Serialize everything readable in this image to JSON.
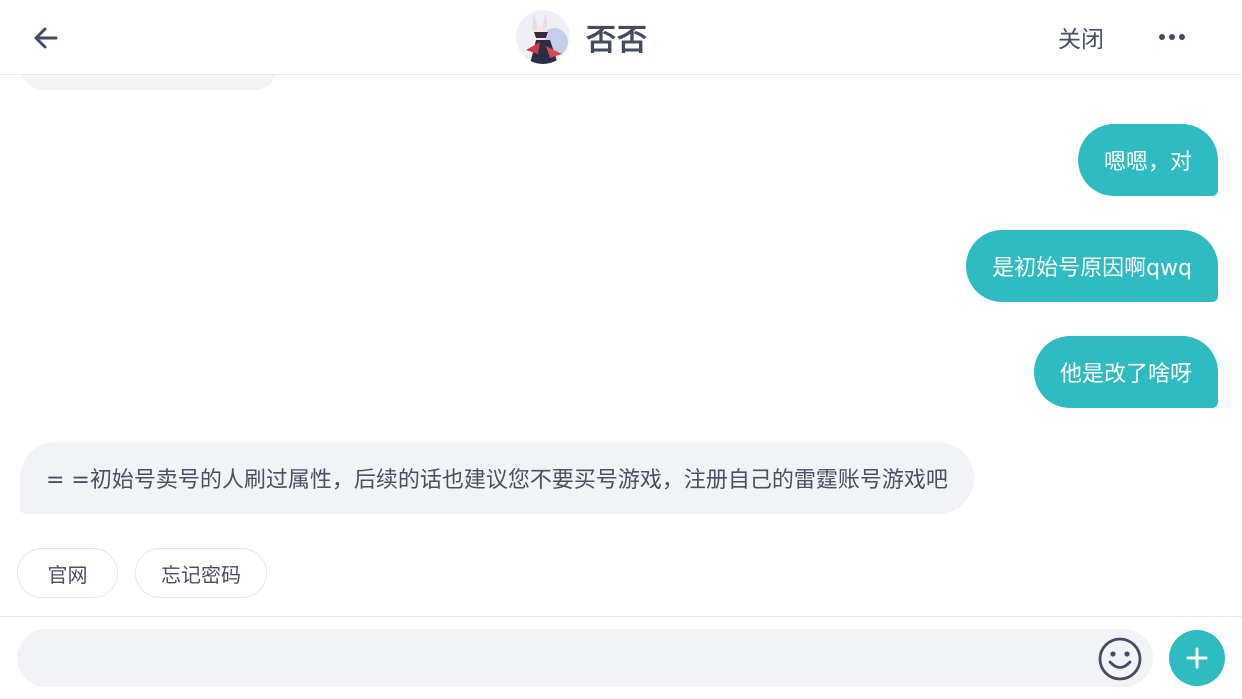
{
  "header": {
    "title": "否否",
    "close_label": "关闭",
    "back_icon": "arrow-left-icon",
    "more_icon": "more-horizontal-icon"
  },
  "messages": [
    {
      "direction": "out",
      "text": "嗯嗯，对"
    },
    {
      "direction": "out",
      "text": "是初始号原因啊qwq"
    },
    {
      "direction": "out",
      "text": "他是改了啥呀"
    },
    {
      "direction": "in",
      "text": "= =初始号卖号的人刷过属性，后续的话也建议您不要买号游戏，注册自己的雷霆账号游戏吧"
    }
  ],
  "quick_replies": [
    "官网",
    "忘记密码"
  ],
  "input": {
    "value": "",
    "placeholder": "",
    "emoji_icon": "emoji-smile-icon",
    "plus_icon": "plus-icon"
  },
  "colors": {
    "accent": "#2ebbc2",
    "bubble_incoming": "#f1f3f7",
    "text": "#4a4f66"
  }
}
